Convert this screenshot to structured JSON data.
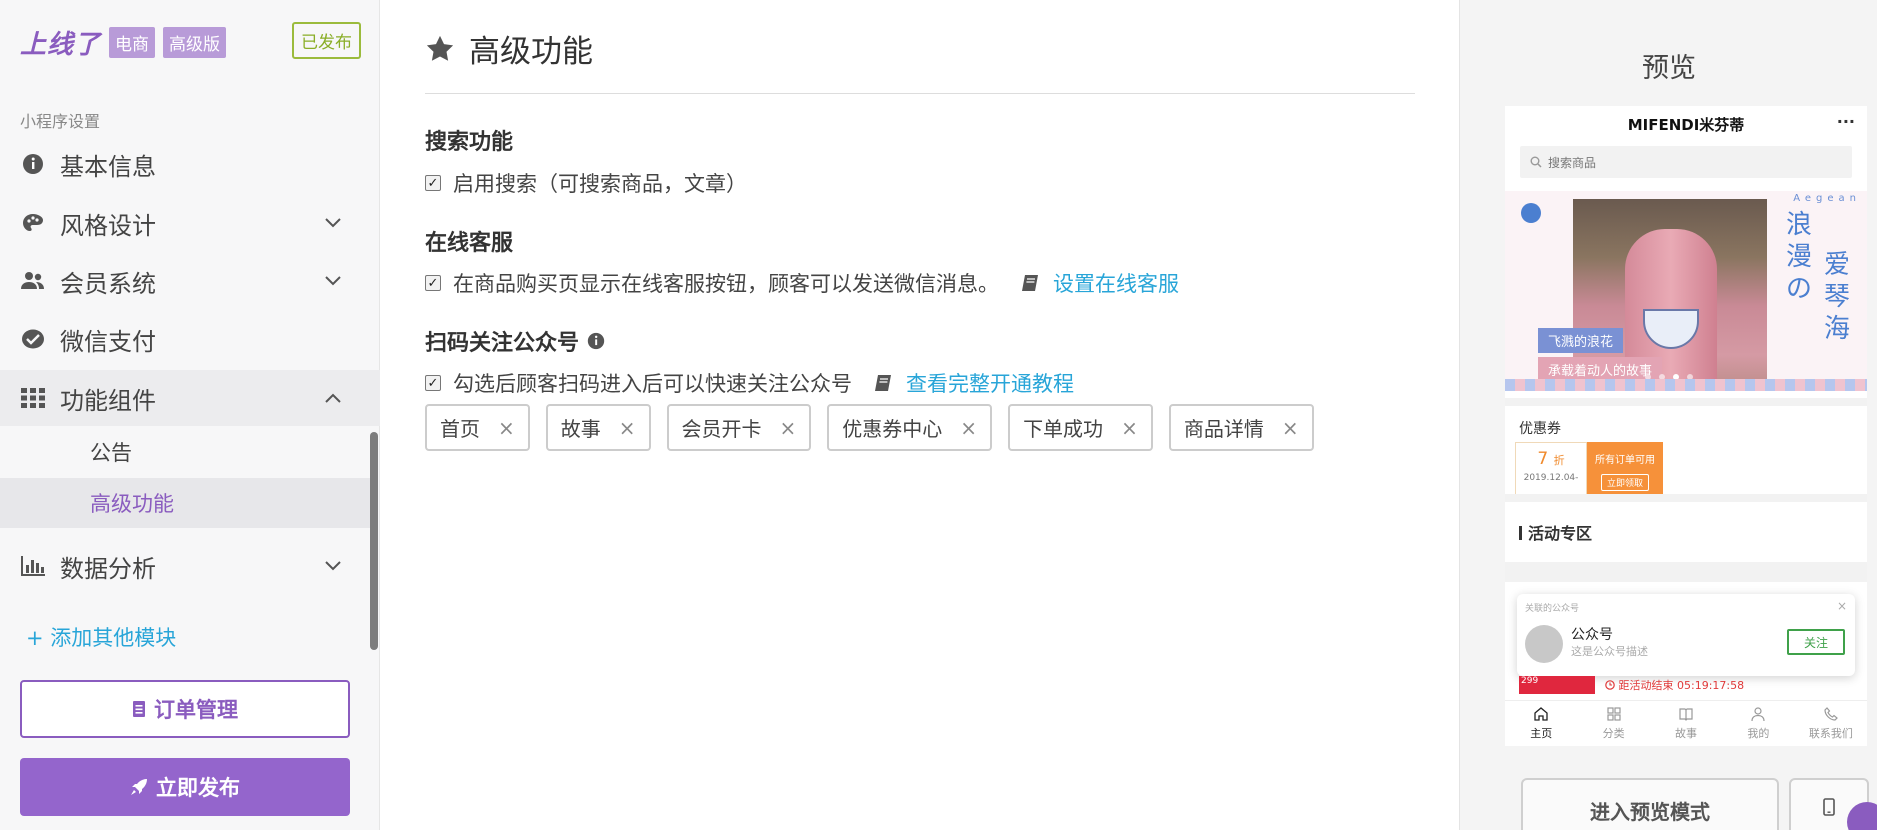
{
  "brand": {
    "logo": "上线了",
    "tag_ecommerce": "电商",
    "tag_edition": "高级版",
    "status_badge": "已发布"
  },
  "sidebar": {
    "section_caption": "小程序设置",
    "items": [
      {
        "label": "基本信息",
        "icon": "info-circle-icon"
      },
      {
        "label": "风格设计",
        "icon": "palette-icon"
      },
      {
        "label": "会员系统",
        "icon": "users-icon"
      },
      {
        "label": "微信支付",
        "icon": "wechat-pay-icon"
      },
      {
        "label": "功能组件",
        "icon": "grid-icon"
      },
      {
        "label": "数据分析",
        "icon": "bar-chart-icon"
      }
    ],
    "sub_items": [
      {
        "label": "公告"
      },
      {
        "label": "高级功能"
      }
    ],
    "add_module": "+ 添加其他模块",
    "orders_button": "订单管理",
    "publish_button": "立即发布"
  },
  "main": {
    "title": "高级功能",
    "search": {
      "heading": "搜索功能",
      "checkbox_label": "启用搜索（可搜索商品，文章）"
    },
    "service": {
      "heading": "在线客服",
      "checkbox_label": "在商品购买页显示在线客服按钮，顾客可以发送微信消息。",
      "link": "设置在线客服"
    },
    "follow": {
      "heading": "扫码关注公众号",
      "checkbox_label": "勾选后顾客扫码进入后可以快速关注公众号",
      "link": "查看完整开通教程",
      "tags": [
        "首页",
        "故事",
        "会员开卡",
        "优惠券中心",
        "下单成功",
        "商品详情"
      ],
      "tag_remove": "×"
    }
  },
  "preview": {
    "title": "预览",
    "phone": {
      "store_name": "MIFENDI米芬蒂",
      "more": "···",
      "search_placeholder": "搜索商品",
      "banner": {
        "aegean": "Aegean",
        "vert_left": "浪漫の",
        "vert_right": "爱琴海",
        "label1": "飞溅的浪花",
        "label2": "承载着动人的故事"
      },
      "coupon": {
        "heading": "优惠券",
        "discount": "7",
        "discount_unit": "折",
        "date": "2019.12.04-",
        "scope": "所有订单可用",
        "claim": "立即领取"
      },
      "activity_heading": "活动专区",
      "popup": {
        "caption": "关联的公众号",
        "close": "×",
        "name": "公众号",
        "desc": "这是公众号描述",
        "follow": "关注"
      },
      "flash": {
        "thumb_price": "299",
        "countdown": "距活动结束 05:19:17:58"
      },
      "tabbar": [
        "主页",
        "分类",
        "故事",
        "我的",
        "联系我们"
      ]
    },
    "enter_preview_button": "进入预览模式"
  }
}
